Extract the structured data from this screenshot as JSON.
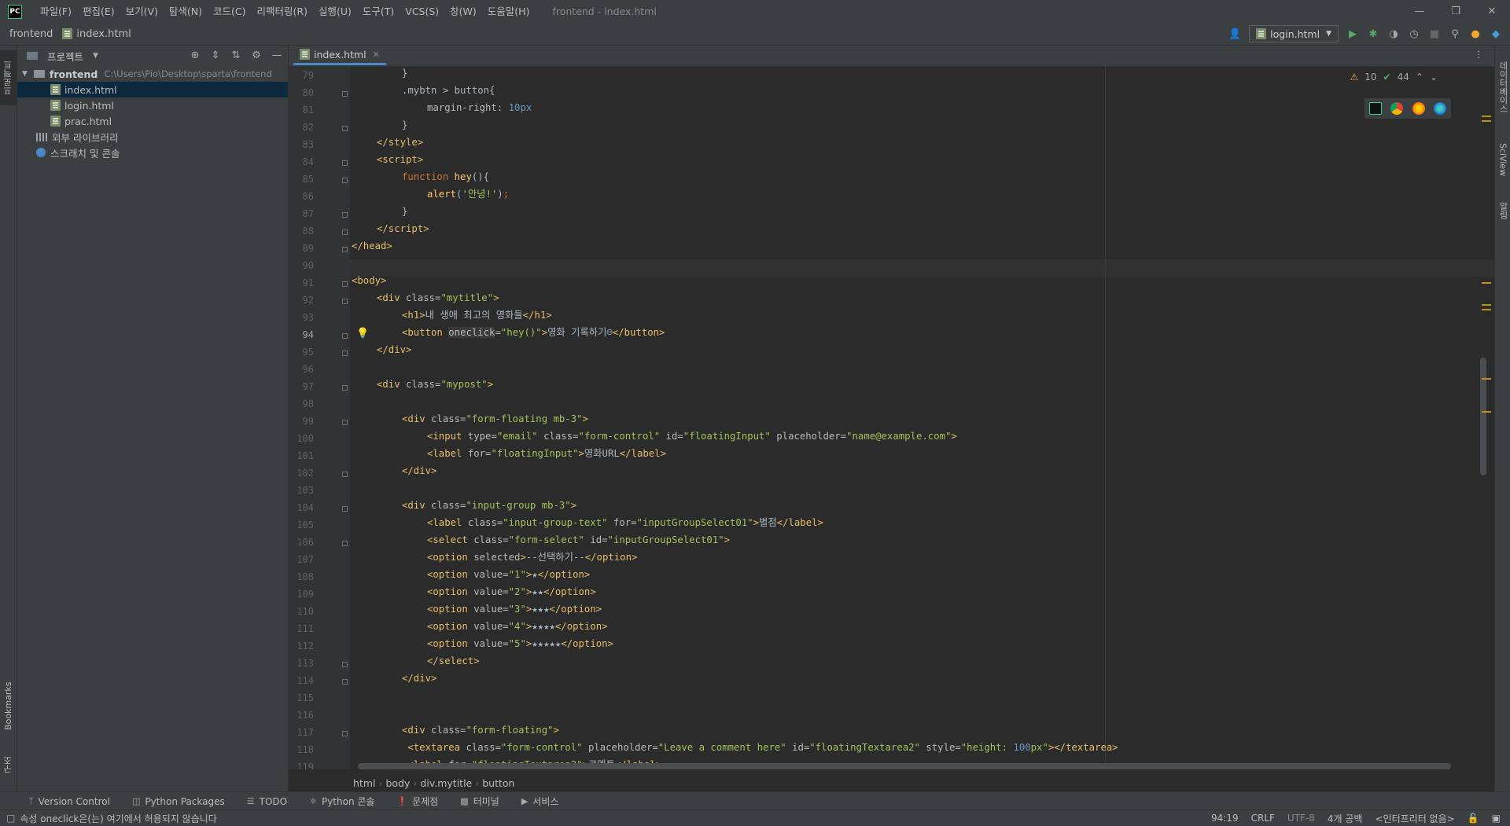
{
  "menubar": {
    "items": [
      "파일(F)",
      "편집(E)",
      "보기(V)",
      "탐색(N)",
      "코드(C)",
      "리팩터링(R)",
      "실행(U)",
      "도구(T)",
      "VCS(S)",
      "창(W)",
      "도움말(H)"
    ],
    "window_title": "frontend - index.html"
  },
  "navbar": {
    "project": "frontend",
    "file": "index.html",
    "run_config": "login.html"
  },
  "left_strip": {
    "project_tab": "프로젝트",
    "bookmarks_tab": "Bookmarks",
    "structure_tab": "구조"
  },
  "project_panel": {
    "title": "프로젝트",
    "root": "frontend",
    "root_path": "C:\\Users\\Pio\\Desktop\\sparta\\frontend",
    "files": [
      "index.html",
      "login.html",
      "prac.html"
    ],
    "external_libs": "외부 라이브러리",
    "scratches": "스크래치 및 콘솔"
  },
  "editor": {
    "tab": "index.html",
    "inspection_warnings": "10",
    "inspection_ok": "44",
    "line_numbers": [
      "79",
      "80",
      "81",
      "82",
      "83",
      "84",
      "85",
      "86",
      "87",
      "88",
      "89",
      "90",
      "91",
      "92",
      "93",
      "94",
      "95",
      "96",
      "97",
      "98",
      "99",
      "100",
      "101",
      "102",
      "103",
      "104",
      "105",
      "106",
      "107",
      "108",
      "109",
      "110",
      "111",
      "112",
      "113",
      "114",
      "115",
      "116",
      "117",
      "118",
      "119"
    ],
    "current_line": "94"
  },
  "right_strip": {
    "db_tab": "데이터베이스",
    "sciview_tab": "SciView",
    "notifications_tab": "알림"
  },
  "breadcrumb": [
    "html",
    "body",
    "div.mytitle",
    "button"
  ],
  "tool_windows": [
    {
      "icon": "version-control-icon",
      "label": "Version Control"
    },
    {
      "icon": "python-packages-icon",
      "label": "Python Packages"
    },
    {
      "icon": "todo-icon",
      "label": "TODO"
    },
    {
      "icon": "python-console-icon",
      "label": "Python 콘솔"
    },
    {
      "icon": "problems-icon",
      "label": "문제점"
    },
    {
      "icon": "terminal-icon",
      "label": "터미널"
    },
    {
      "icon": "services-icon",
      "label": "서비스"
    }
  ],
  "statusbar": {
    "message": "속성 oneclick은(는) 여기에서 허용되지 않습니다",
    "position": "94:19",
    "line_sep": "CRLF",
    "encoding": "UTF-8",
    "indent": "4개 공백",
    "interpreter": "<인터프리터 없음>"
  },
  "colors": {
    "background": "#2b2b2b",
    "panel": "#3c3f41",
    "selection": "#0d293e",
    "tag": "#e8bf6a",
    "string": "#a5c25c",
    "keyword": "#cc7832"
  }
}
